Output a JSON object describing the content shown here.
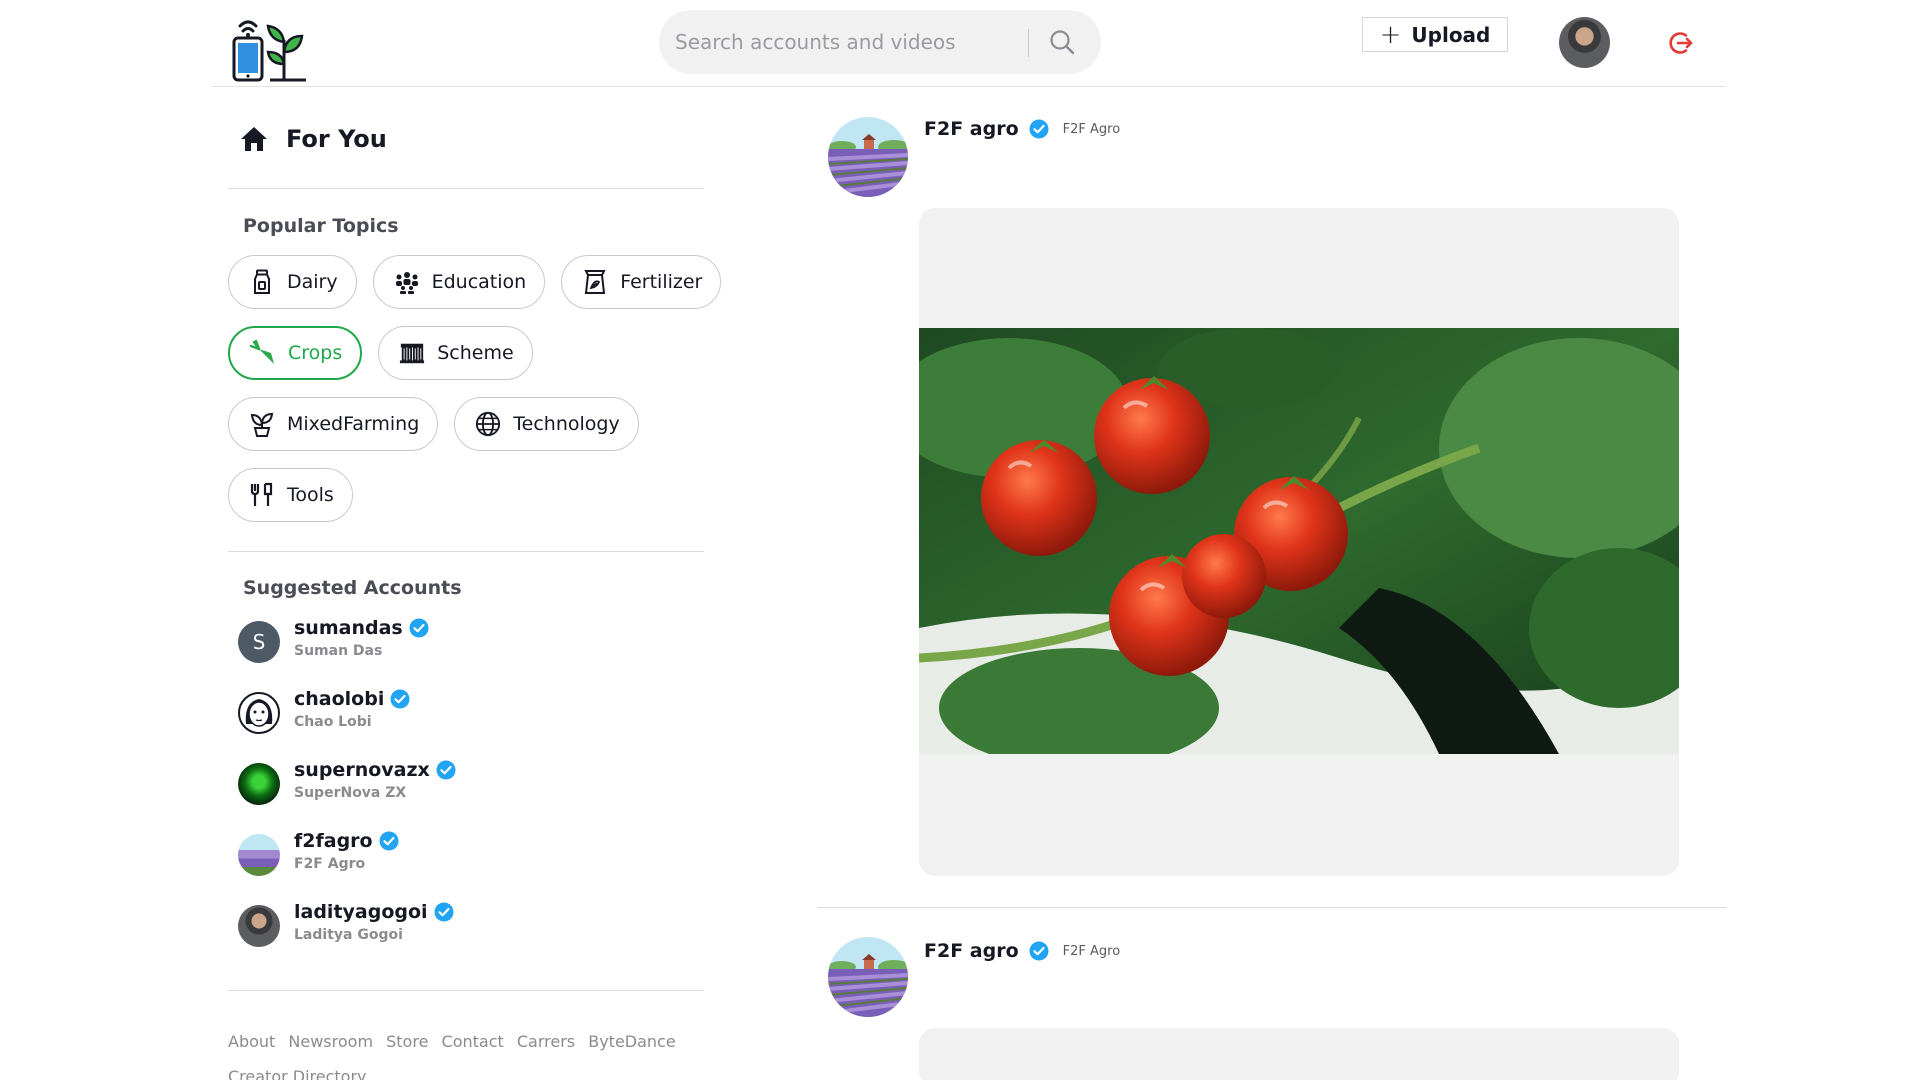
{
  "header": {
    "logo_icon": "phone-sprout-logo-icon",
    "search_placeholder": "Search accounts and videos",
    "search_icon": "search-icon",
    "upload_label": "Upload",
    "upload_icon": "plus-icon",
    "logout_icon": "logout-icon"
  },
  "sidebar": {
    "for_you_label": "For You",
    "popular_topics_title": "Popular Topics",
    "topics": [
      {
        "label": "Dairy",
        "icon": "milk-bottle-icon"
      },
      {
        "label": "Education",
        "icon": "group-people-icon"
      },
      {
        "label": "Fertilizer",
        "icon": "fertilizer-bag-icon"
      },
      {
        "label": "Crops",
        "icon": "carrot-icon",
        "active": true
      },
      {
        "label": "Scheme",
        "icon": "government-building-icon"
      },
      {
        "label": "MixedFarming",
        "icon": "plant-pot-icon"
      },
      {
        "label": "Technology",
        "icon": "globe-icon"
      },
      {
        "label": "Tools",
        "icon": "tools-icon"
      }
    ],
    "suggested_title": "Suggested Accounts",
    "accounts": [
      {
        "username": "sumandas",
        "name": "Suman Das",
        "avatar_letter": "S"
      },
      {
        "username": "chaolobi",
        "name": "Chao Lobi"
      },
      {
        "username": "supernovazx",
        "name": "SuperNova ZX"
      },
      {
        "username": "f2fagro",
        "name": "F2F Agro"
      },
      {
        "username": "ladityagogoi",
        "name": "Laditya Gogoi"
      }
    ],
    "footer_links": [
      "About",
      "Newsroom",
      "Store",
      "Contact",
      "Carrers",
      "ByteDance",
      "Creator Directory"
    ]
  },
  "feed": {
    "posts": [
      {
        "username": "F2F agro",
        "name": "F2F Agro",
        "verified": true,
        "media": "cherry-tomatoes-video"
      },
      {
        "username": "F2F agro",
        "name": "F2F Agro",
        "verified": true
      }
    ]
  },
  "colors": {
    "accent_green": "#1fa84a",
    "verified_blue": "#20a4f3",
    "logout_red": "#e53935"
  }
}
